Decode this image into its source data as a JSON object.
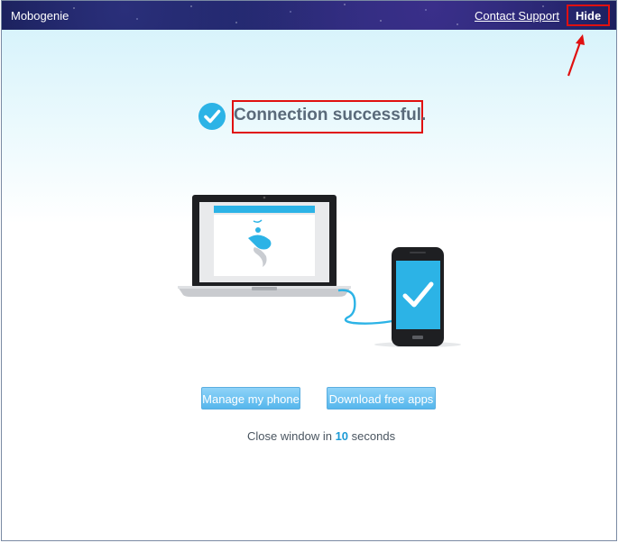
{
  "window": {
    "app_name": "Mobogenie",
    "contact_link": "Contact Support",
    "hide_label": "Hide"
  },
  "status": {
    "title": "Connection successful."
  },
  "buttons": {
    "manage": "Manage my phone",
    "download": "Download free apps"
  },
  "countdown": {
    "prefix": "Close window in",
    "seconds": "10",
    "suffix": "seconds"
  },
  "colors": {
    "accent": "#2cb3e6",
    "annotation_red": "#e01010",
    "title_text": "#5a6a7a"
  },
  "icons": {
    "check": "check-circle-icon",
    "laptop": "laptop-icon",
    "phone": "smartphone-icon",
    "cable": "usb-cable-icon",
    "logo": "mobogenie-logo-icon"
  }
}
